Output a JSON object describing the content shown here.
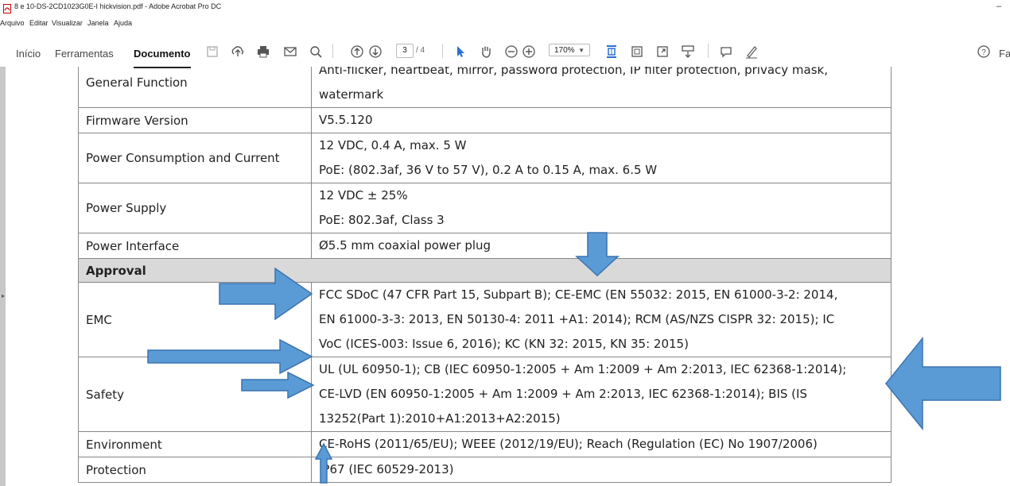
{
  "window": {
    "title": "8 e 10-DS-2CD1023G0E-I hickvision.pdf - Adobe Acrobat Pro DC",
    "minimize_glyph": "–"
  },
  "menu": [
    "Arquivo",
    "Editar",
    "Visualizar",
    "Janela",
    "Ajuda"
  ],
  "toolbar": {
    "tabs": [
      "Início",
      "Ferramentas",
      "Documento"
    ],
    "active_tab": "Documento",
    "page_current": "3",
    "page_total": "/ 4",
    "zoom": "170%",
    "right_cutoff_text": "Fa",
    "icons": [
      "save-icon",
      "upload-icon",
      "print-icon",
      "email-icon",
      "search-icon",
      "page-up-icon",
      "page-down-icon",
      "select-pointer-icon",
      "hand-tool-icon",
      "zoom-out-icon",
      "zoom-in-icon",
      "fit-page-icon",
      "page-view-icon",
      "fullscreen-icon",
      "scroll-mode-icon",
      "comment-icon",
      "sign-icon",
      "help-icon"
    ]
  },
  "table": {
    "rows": [
      {
        "label": "General Function",
        "lines": [
          "Anti-flicker, heartbeat, mirror, password protection, IP filter protection, privacy mask,",
          "watermark"
        ]
      },
      {
        "label": "Firmware Version",
        "lines": [
          "V5.5.120"
        ]
      },
      {
        "label": "Power Consumption and Current",
        "lines": [
          "12 VDC, 0.4 A, max. 5 W",
          "PoE: (802.3af, 36 V to 57 V), 0.2 A to 0.15 A, max. 6.5 W"
        ]
      },
      {
        "label": "Power Supply",
        "lines": [
          "12 VDC ± 25%",
          "PoE: 802.3af, Class 3"
        ]
      },
      {
        "label": "Power Interface",
        "lines": [
          "Ø5.5 mm coaxial power plug"
        ]
      },
      {
        "section": "Approval"
      },
      {
        "label": "EMC",
        "lines": [
          "FCC SDoC (47 CFR Part 15, Subpart B); CE-EMC (EN 55032: 2015, EN 61000-3-2: 2014,",
          "EN 61000-3-3: 2013, EN 50130-4: 2011 +A1: 2014); RCM (AS/NZS CISPR 32: 2015); IC",
          "VoC (ICES-003: Issue 6, 2016); KC (KN 32: 2015, KN 35: 2015)"
        ]
      },
      {
        "label": "Safety",
        "lines": [
          "UL (UL 60950-1); CB (IEC 60950-1:2005 + Am 1:2009 + Am 2:2013, IEC 62368-1:2014);",
          "CE-LVD (EN 60950-1:2005 + Am 1:2009 + Am 2:2013, IEC 62368-1:2014); BIS (IS",
          "13252(Part 1):2010+A1:2013+A2:2015)"
        ]
      },
      {
        "label": "Environment",
        "lines": [
          "CE-RoHS (2011/65/EU); WEEE (2012/19/EU); Reach (Regulation (EC) No 1907/2006)"
        ]
      },
      {
        "label": "Protection",
        "lines": [
          "IP67 (IEC 60529-2013)"
        ]
      }
    ]
  },
  "annotations": {
    "arrow_color": "#5b9bd5",
    "arrow_stroke": "#3a73b0"
  }
}
